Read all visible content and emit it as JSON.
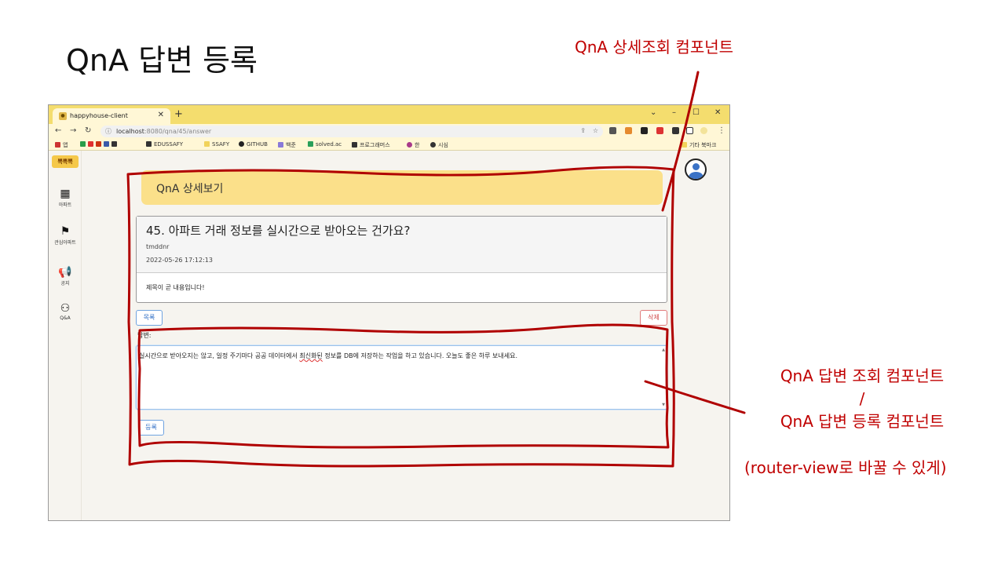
{
  "slide": {
    "title": "QnA 답변 등록",
    "annotation_top": "QnA 상세조회 컴포넌트",
    "annotation_right_line1": "QnA 답변 조회 컴포넌트",
    "annotation_right_sep": "/",
    "annotation_right_line2": "QnA 답변 등록 컴포넌트",
    "annotation_note": "(router-view로 바꿀 수 있게)",
    "annotation_color": "#c00000"
  },
  "browser": {
    "tab_title": "happyhouse-client",
    "url_host": "localhost",
    "url_path": ":8080/qna/45/answer",
    "bookmarks": [
      "앱",
      "EDUSSAFY",
      "SSAFY",
      "GITHUB",
      "백준",
      "solved.ac",
      "프로그래머스",
      "한",
      "시심"
    ],
    "other_bookmarks": "기타 북마크",
    "tab_bar_color": "#f4dd6e"
  },
  "sidebar": {
    "logo": "뽁뽁뽁",
    "items": [
      {
        "label": "아파트",
        "icon": "building-icon"
      },
      {
        "label": "관심아파트",
        "icon": "flag-icon"
      },
      {
        "label": "공지",
        "icon": "megaphone-icon"
      },
      {
        "label": "Q&A",
        "icon": "qna-icon"
      }
    ]
  },
  "detail": {
    "header": "QnA 상세보기",
    "title": "45. 아파트 거래 정보를 실시간으로 받아오는 건가요?",
    "author": "tmddnr",
    "date": "2022-05-26 17:12:13",
    "content": "제목이 곧 내용입니다!",
    "list_button": "목록",
    "delete_button": "삭제"
  },
  "answer": {
    "label": "답변:",
    "text_before": "실시간으로 받아오지는 않고, 일정 주기마다 공공 데이터에서 ",
    "text_underlined": "최신화된",
    "text_after": " 정보를 DB에 저장하는 작업을 하고 있습니다. 오늘도 좋은 하루 보내세요.",
    "submit_button": "등록"
  }
}
